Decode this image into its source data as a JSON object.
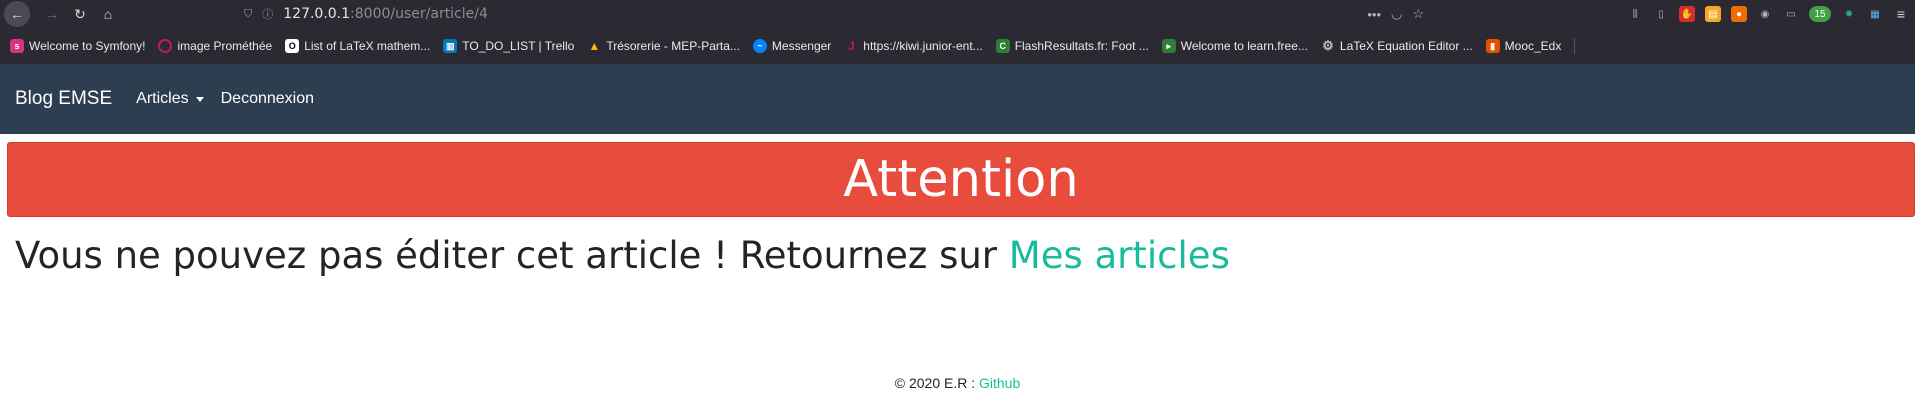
{
  "browser": {
    "url_host": "127.0.0.1",
    "url_path": ":8000/user/article/4"
  },
  "bookmarks": [
    {
      "label": "Welcome to Symfony!",
      "icon": "symfony-icon",
      "color": "#d63384"
    },
    {
      "label": "image  Prométhée",
      "icon": "circle-icon",
      "color": "#c2185b"
    },
    {
      "label": "List of LaTeX mathem...",
      "icon": "oeis-icon",
      "color": "#000000"
    },
    {
      "label": "TO_DO_LIST | Trello",
      "icon": "trello-icon",
      "color": "#0079bf"
    },
    {
      "label": "Trésorerie - MEP-Parta...",
      "icon": "drive-icon",
      "color": "#fbbc04"
    },
    {
      "label": "Messenger",
      "icon": "messenger-icon",
      "color": "#0084ff"
    },
    {
      "label": "https://kiwi.junior-ent...",
      "icon": "kiwi-icon",
      "color": "#c2185b"
    },
    {
      "label": "FlashResultats.fr: Foot ...",
      "icon": "flash-icon",
      "color": "#2e7d32"
    },
    {
      "label": "Welcome to learn.free...",
      "icon": "learn-icon",
      "color": "#2e7d32"
    },
    {
      "label": "LaTeX Equation Editor ...",
      "icon": "gear-icon",
      "color": "#9e9e9e"
    },
    {
      "label": "Mooc_Edx",
      "icon": "book-icon",
      "color": "#e65100"
    }
  ],
  "navbar": {
    "brand": "Blog EMSE",
    "articles": "Articles",
    "logout": "Deconnexion"
  },
  "alert": {
    "title": "Attention"
  },
  "message": {
    "text": "Vous ne pouvez pas éditer cet article ! Retournez sur ",
    "link": "Mes articles"
  },
  "footer": {
    "text": "© 2020 E.R : ",
    "link": "Github"
  },
  "colors": {
    "navbar": "#2c3e50",
    "alert": "#e74c3c",
    "link": "#18bc9c"
  }
}
